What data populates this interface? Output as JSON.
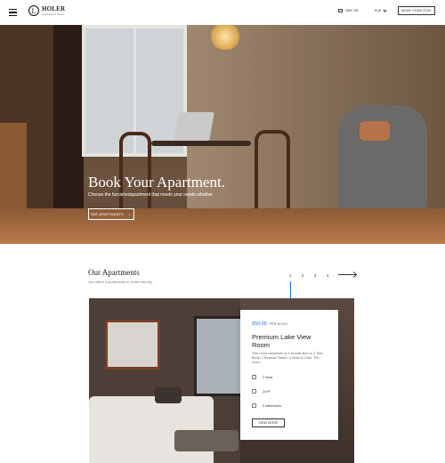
{
  "header": {
    "logo_letter": "L",
    "logo_name": "HOLER",
    "logo_sub": "apartment hotel",
    "phone": "1800 780",
    "currency": "EUR",
    "book_label": "BOOK YOUR STAY"
  },
  "hero": {
    "title": "Book Your Apartment.",
    "subtitle": "Choose the furnishedapartment that meets your needs whether",
    "cta_label": "SEE APARTMENTS"
  },
  "apartments": {
    "title": "Our Apartments",
    "subtitle": "Our offers 4 apartments in centre the city",
    "pages": [
      "1",
      "2",
      "3",
      "4"
    ],
    "card": {
      "price": "€50.00",
      "per": "PER NIGHT",
      "room_title": "Premium Lake View Room",
      "description": "This room comprises of 1 Double Bed or 2 Twin Beds, 2 Bedside Tables, a Desk & Chair. The room...",
      "features": [
        {
          "icon": "bed-icon",
          "label": "2 beds"
        },
        {
          "icon": "area-icon",
          "label": "24 ft²"
        },
        {
          "icon": "bath-icon",
          "label": "2 bathrooms"
        }
      ],
      "view_label": "VIEW MORE"
    }
  },
  "colors": {
    "accent": "#1a73e8",
    "text": "#1f1f1f"
  }
}
